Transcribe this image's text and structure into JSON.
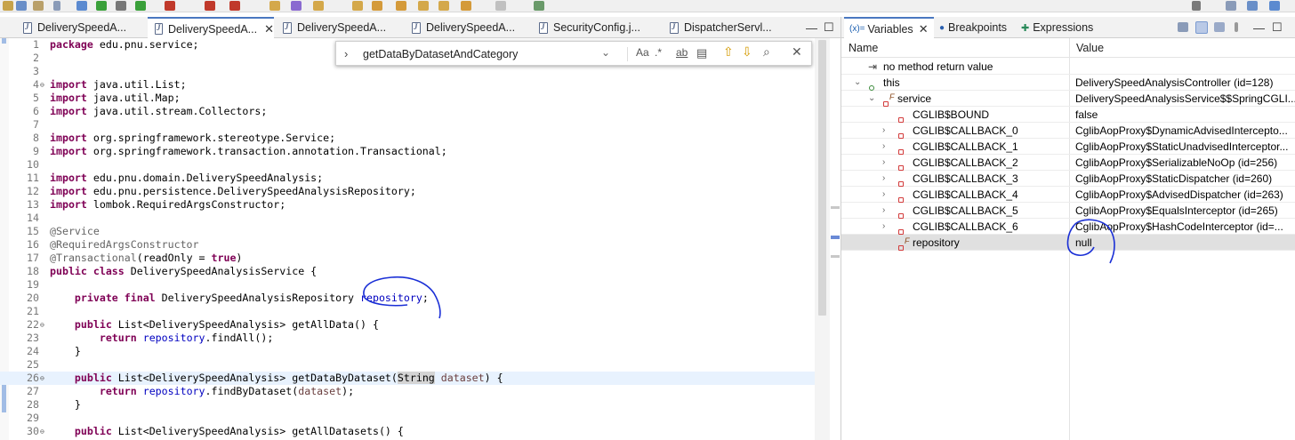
{
  "editor_tabs": [
    {
      "label": "DeliverySpeedA...",
      "active": false
    },
    {
      "label": "DeliverySpeedA...",
      "active": true
    },
    {
      "label": "DeliverySpeedA...",
      "active": false
    },
    {
      "label": "DeliverySpeedA...",
      "active": false
    },
    {
      "label": "SecurityConfig.j...",
      "active": false
    },
    {
      "label": "DispatcherServl...",
      "active": false
    }
  ],
  "find_bar": {
    "query": "getDataByDatasetAndCategory",
    "case_label": "Aa",
    "regex_label": ".*",
    "word_label": "ab"
  },
  "view_tabs": {
    "variables": "Variables",
    "variables_prefix": "(x)=",
    "breakpoints": "Breakpoints",
    "expressions": "Expressions"
  },
  "table": {
    "name_header": "Name",
    "value_header": "Value"
  },
  "variables": [
    {
      "name": "no method return value",
      "value": ""
    },
    {
      "name": "this",
      "value": "DeliverySpeedAnalysisController  (id=128)"
    },
    {
      "name": "service",
      "value": "DeliverySpeedAnalysisService$$SpringCGLI..."
    },
    {
      "name": "CGLIB$BOUND",
      "value": "false"
    },
    {
      "name": "CGLIB$CALLBACK_0",
      "value": "CglibAopProxy$DynamicAdvisedIntercepto..."
    },
    {
      "name": "CGLIB$CALLBACK_1",
      "value": "CglibAopProxy$StaticUnadvisedInterceptor..."
    },
    {
      "name": "CGLIB$CALLBACK_2",
      "value": "CglibAopProxy$SerializableNoOp  (id=256)"
    },
    {
      "name": "CGLIB$CALLBACK_3",
      "value": "CglibAopProxy$StaticDispatcher  (id=260)"
    },
    {
      "name": "CGLIB$CALLBACK_4",
      "value": "CglibAopProxy$AdvisedDispatcher  (id=263)"
    },
    {
      "name": "CGLIB$CALLBACK_5",
      "value": "CglibAopProxy$EqualsInterceptor  (id=265)"
    },
    {
      "name": "CGLIB$CALLBACK_6",
      "value": "CglibAopProxy$HashCodeInterceptor  (id=..."
    },
    {
      "name": "repository",
      "value": "null"
    }
  ],
  "code": {
    "ln": [
      "1",
      "2",
      "3",
      "4",
      "5",
      "6",
      "7",
      "8",
      "9",
      "10",
      "11",
      "12",
      "13",
      "14",
      "15",
      "16",
      "17",
      "18",
      "19",
      "20",
      "21",
      "22",
      "23",
      "24",
      "25",
      "26",
      "27",
      "28",
      "29",
      "30"
    ],
    "l1_kw": "package",
    "l1_rest": " edu.pnu.service;",
    "import_kw": "import",
    "l4": " java.util.List;",
    "l5": " java.util.Map;",
    "l6": " java.util.stream.Collectors;",
    "l8": " org.springframework.stereotype.Service;",
    "l9": " org.springframework.transaction.annotation.Transactional;",
    "l11": " edu.pnu.domain.DeliverySpeedAnalysis;",
    "l12": " edu.pnu.persistence.DeliverySpeedAnalysisRepository;",
    "l13": " lombok.RequiredArgsConstructor;",
    "l15": "@Service",
    "l16": "@RequiredArgsConstructor",
    "l17_an": "@Transactional",
    "l17_a": "(readOnly = ",
    "l17_kw": "true",
    "l17_b": ")",
    "l18_kw": "public class",
    "l18_rest": " DeliverySpeedAnalysisService {",
    "l20_kw": "private final",
    "l20_type": " DeliverySpeedAnalysisRepository ",
    "l20_fd": "repository",
    "l20_end": ";",
    "public_kw": "public",
    "return_kw": "return",
    "l22_rest": " List<DeliverySpeedAnalysis> getAllData() {",
    "l23_fd": "repository",
    "l23_rest": ".findAll();",
    "brace": "}",
    "l26_a": " List<DeliverySpeedAnalysis> getDataByDataset(",
    "l26_sel": "String",
    "l26_pm": " dataset",
    "l26_b": ") {",
    "l27_fd": "repository",
    "l27_a": ".findByDataset(",
    "l27_pm": "dataset",
    "l27_b": ");",
    "l30_rest": " List<DeliverySpeedAnalysis> getAllDatasets() {"
  }
}
